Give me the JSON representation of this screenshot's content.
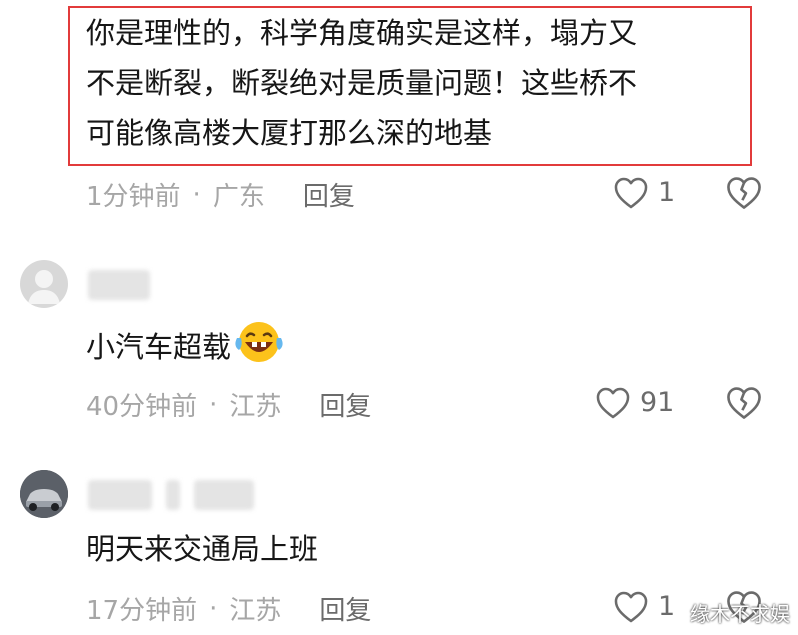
{
  "highlighted_comment": {
    "lines": [
      "你是理性的，科学角度确实是这样，塌方又",
      "不是断裂，断裂绝对是质量问题！这些桥不",
      "可能像高楼大厦打那么深的地基"
    ],
    "time": "1分钟前",
    "region": "广东",
    "reply_label": "回复",
    "likes": "1",
    "highlight_color": "#e23b3b"
  },
  "comments": [
    {
      "text": "小汽车超载",
      "emoji": "laughing-tears-emoji",
      "time": "40分钟前",
      "region": "江苏",
      "reply_label": "回复",
      "likes": "91",
      "avatar": "default-avatar"
    },
    {
      "text": "明天来交通局上班",
      "time": "17分钟前",
      "region": "江苏",
      "reply_label": "回复",
      "likes": "1",
      "avatar": "car-avatar"
    }
  ],
  "separator": "·",
  "watermark": "缘木不求娱",
  "icons": {
    "like": "heart-outline-icon",
    "dislike": "broken-heart-icon"
  }
}
